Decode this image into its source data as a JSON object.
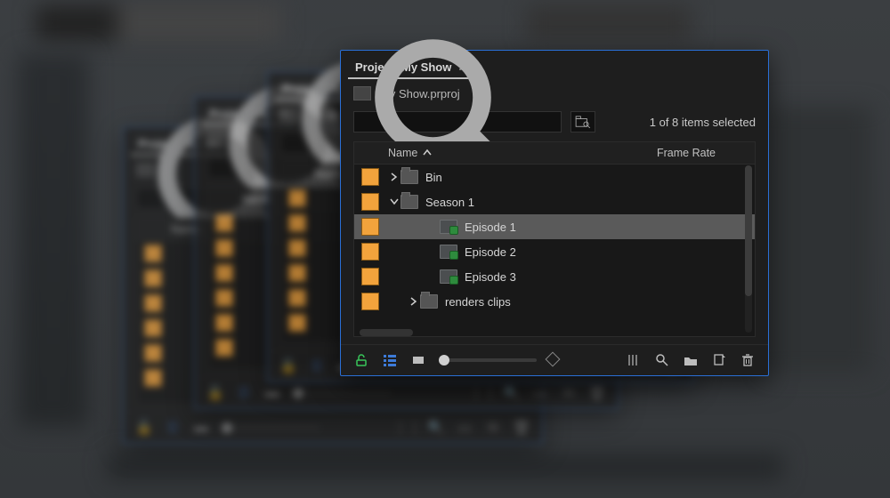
{
  "panel": {
    "title": "Project: My Show",
    "filename": "My Show.prproj",
    "status": "1 of 8 items selected",
    "search_placeholder": ""
  },
  "columns": {
    "name": "Name",
    "frame_rate": "Frame Rate"
  },
  "rows": [
    {
      "label": "Bin",
      "icon": "folder",
      "depth": 0,
      "expander": "closed",
      "selected": false
    },
    {
      "label": "Season 1",
      "icon": "folder",
      "depth": 0,
      "expander": "open",
      "selected": false
    },
    {
      "label": "Episode 1",
      "icon": "seq",
      "depth": 2,
      "expander": "none",
      "selected": true
    },
    {
      "label": "Episode 2",
      "icon": "seq",
      "depth": 2,
      "expander": "none",
      "selected": false
    },
    {
      "label": "Episode 3",
      "icon": "seq",
      "depth": 2,
      "expander": "none",
      "selected": false
    },
    {
      "label": "renders clips",
      "icon": "folder",
      "depth": 1,
      "expander": "closed",
      "selected": false
    }
  ],
  "ghost_title": "Project: My Sh",
  "ghost_name_col": "Name"
}
